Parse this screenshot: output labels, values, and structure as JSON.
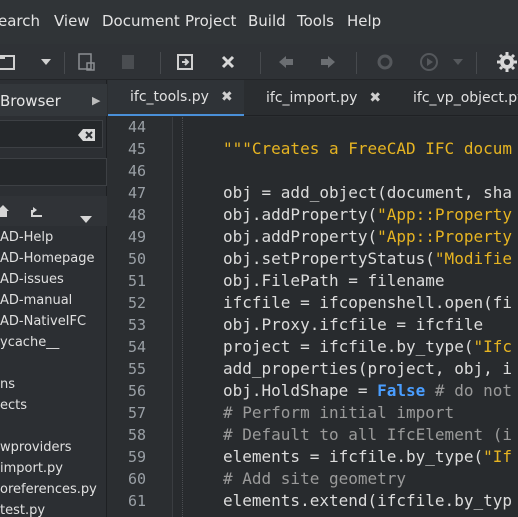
{
  "menu": [
    "earch",
    "View",
    "Document",
    "Project",
    "Build",
    "Tools",
    "Help"
  ],
  "panel": {
    "title": "Browser",
    "items": [
      "AD-Help",
      "AD-Homepage",
      "AD-issues",
      "AD-manual",
      "AD-NativeIFC",
      "ycache__",
      "",
      "ns",
      "ects",
      "",
      "wproviders",
      "import.py",
      "oreferences.py",
      "test.py"
    ]
  },
  "tabs": [
    {
      "label": "ifc_tools.py",
      "close": "✖"
    },
    {
      "label": "ifc_import.py",
      "close": "✖"
    },
    {
      "label": "ifc_vp_object.py",
      "close": ""
    }
  ],
  "lines": [
    "44",
    "45",
    "46",
    "47",
    "48",
    "49",
    "50",
    "51",
    "52",
    "53",
    "54",
    "55",
    "56",
    "57",
    "58",
    "59",
    "60",
    "61"
  ],
  "code": {
    "l45": "\"\"\"Creates a FreeCAD IFC docum",
    "l47": "obj = add_object(document, sha",
    "l48a": "obj.addProperty(",
    "l48b": "\"App::Property",
    "l49a": "obj.addProperty(",
    "l49b": "\"App::Property",
    "l50a": "obj.setPropertyStatus(",
    "l50b": "\"Modifie",
    "l51": "obj.FilePath = filename",
    "l52": "ifcfile = ifcopenshell.open(fi",
    "l53": "obj.Proxy.ifcfile = ifcfile",
    "l54a": "project = ifcfile.by_type(",
    "l54b": "\"Ifc",
    "l55": "add_properties(project, obj, i",
    "l56a": "obj.HoldShape = ",
    "l56b": "False",
    "l56c": " # do not",
    "l57": "# Perform initial import",
    "l58": "# Default to all IfcElement (i",
    "l59a": "elements = ifcfile.by_type(",
    "l59b": "\"If",
    "l60": "# Add site geometry",
    "l61": "elements.extend(ifcfile.by_typ"
  }
}
